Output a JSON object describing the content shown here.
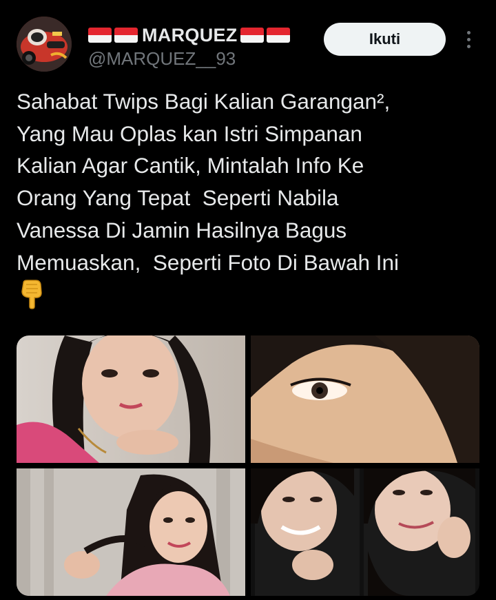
{
  "account": {
    "display_name": "MARQUEZ",
    "handle": "@MARQUEZ__93",
    "flag_emoji_name": "flag-indonesia-icon"
  },
  "actions": {
    "follow_label": "Ikuti",
    "more_icon": "more-vertical-icon"
  },
  "tweet": {
    "text": "Sahabat Twips Bagi Kalian Garangan², \nYang Mau Oplas kan Istri Simpanan \nKalian Agar Cantik, Mintalah Info Ke \nOrang Yang Tepat  Seperti Nabila \nVanessa Di Jamin Hasilnya Bagus \nMemuaskan,  Seperti Foto Di Bawah Ini",
    "trailing_emoji": "pointing-down-hand-icon"
  },
  "media": [
    {
      "name": "photo-woman-pink-shirt"
    },
    {
      "name": "photo-close-up-eye"
    },
    {
      "name": "photo-woman-smiling-gray-background"
    },
    {
      "name": "photo-selfie-collage"
    }
  ],
  "colors": {
    "background": "#000000",
    "text_primary": "#e7e9ea",
    "text_secondary": "#71767b",
    "follow_bg": "#eff3f4",
    "follow_text": "#0f1419",
    "flag_red": "#e4262f",
    "flag_white": "#f5f5f5"
  }
}
